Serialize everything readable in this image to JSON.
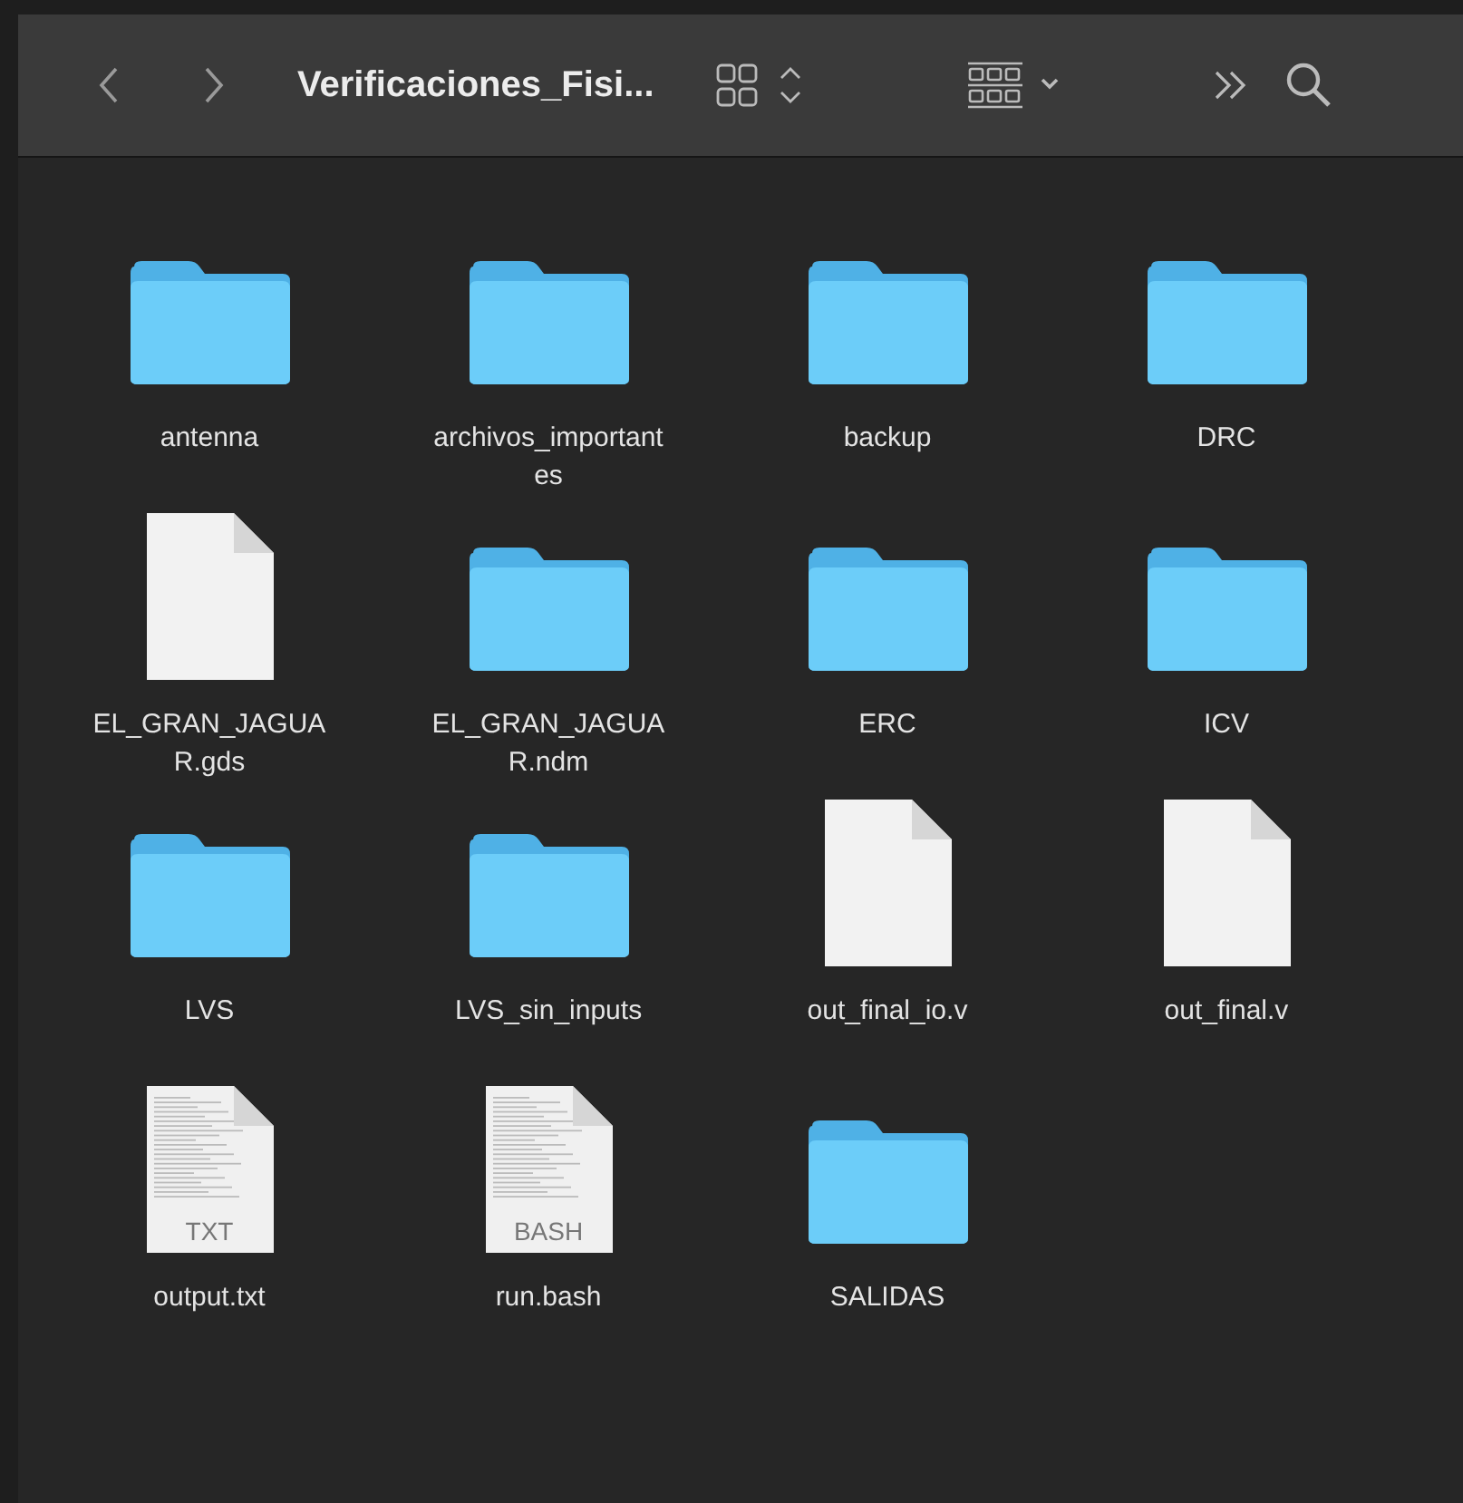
{
  "toolbar": {
    "title": "Verificaciones_Fisi..."
  },
  "items": [
    {
      "name": "antenna",
      "kind": "folder"
    },
    {
      "name": "archivos_importantes",
      "kind": "folder"
    },
    {
      "name": "backup",
      "kind": "folder"
    },
    {
      "name": "DRC",
      "kind": "folder"
    },
    {
      "name": "EL_GRAN_JAGUAR.gds",
      "kind": "document"
    },
    {
      "name": "EL_GRAN_JAGUAR.ndm",
      "kind": "folder"
    },
    {
      "name": "ERC",
      "kind": "folder"
    },
    {
      "name": "ICV",
      "kind": "folder"
    },
    {
      "name": "LVS",
      "kind": "folder"
    },
    {
      "name": "LVS_sin_inputs",
      "kind": "folder"
    },
    {
      "name": "out_final_io.v",
      "kind": "document"
    },
    {
      "name": "out_final.v",
      "kind": "document"
    },
    {
      "name": "output.txt",
      "kind": "text-document",
      "badge": "TXT"
    },
    {
      "name": "run.bash",
      "kind": "text-document",
      "badge": "BASH"
    },
    {
      "name": "SALIDAS",
      "kind": "folder"
    }
  ]
}
